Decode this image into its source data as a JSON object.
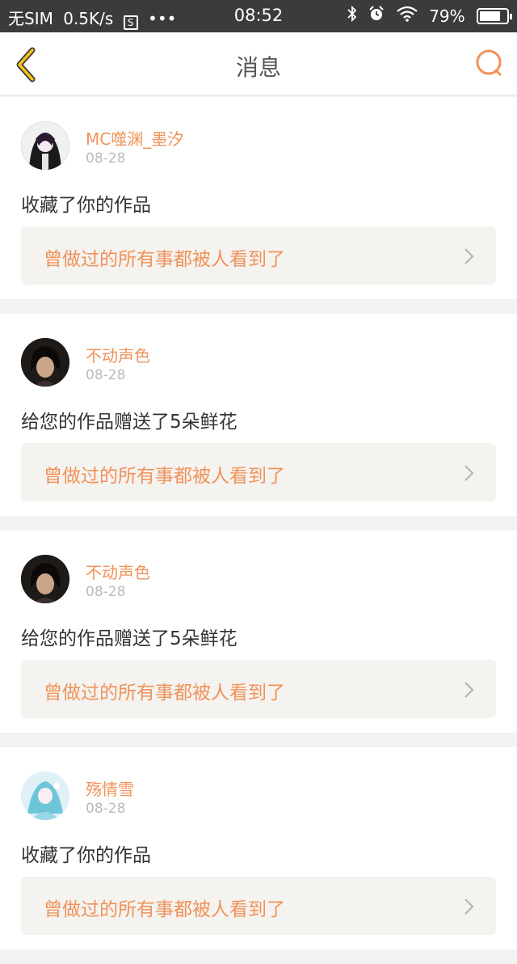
{
  "status_bar": {
    "carrier": "无SIM",
    "speed": "0.5K/s",
    "sim_icon_label": "S",
    "dots": "•••",
    "time": "08:52",
    "battery": "79%",
    "battery_level": 0.79
  },
  "header": {
    "title": "消息"
  },
  "colors": {
    "accent": "#f0925a",
    "back_arrow": "#f5c518",
    "card_bg": "#f4f3ef"
  },
  "messages": [
    {
      "username": "MC噬渊_墨汐",
      "date": "08-28",
      "action": "收藏了你的作品",
      "work_title": "曾做过的所有事都被人看到了"
    },
    {
      "username": "不动声色",
      "date": "08-28",
      "action": "给您的作品赠送了5朵鲜花",
      "work_title": "曾做过的所有事都被人看到了"
    },
    {
      "username": "不动声色",
      "date": "08-28",
      "action": "给您的作品赠送了5朵鲜花",
      "work_title": "曾做过的所有事都被人看到了"
    },
    {
      "username": "殇情雪",
      "date": "08-28",
      "action": "收藏了你的作品",
      "work_title": "曾做过的所有事都被人看到了"
    }
  ]
}
